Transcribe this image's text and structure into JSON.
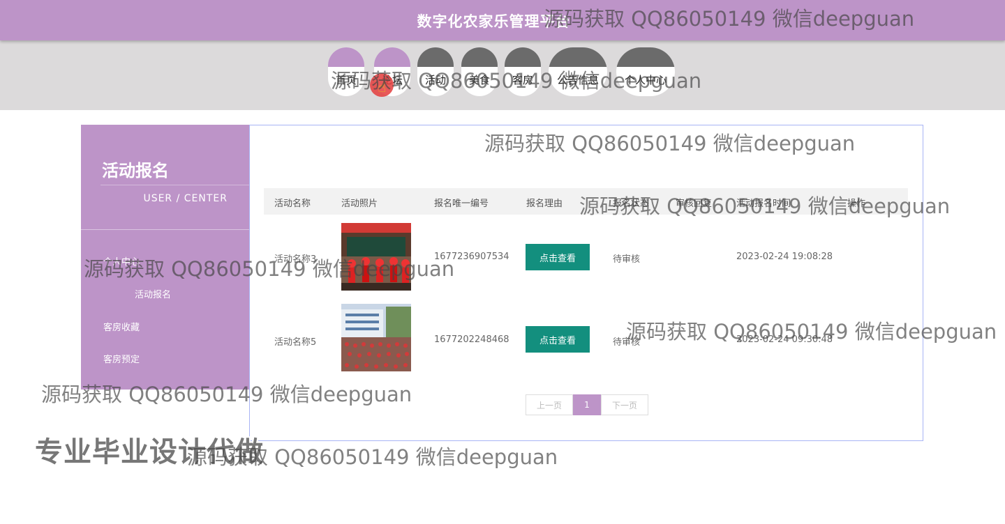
{
  "header": {
    "title": "数字化农家乐管理平台"
  },
  "nav": [
    {
      "label": "首页",
      "active": true
    },
    {
      "label": "论坛",
      "active": true
    },
    {
      "label": "活动",
      "active": false
    },
    {
      "label": "美食",
      "active": false
    },
    {
      "label": "客房",
      "active": false
    },
    {
      "label": "公告信息",
      "active": false
    },
    {
      "label": "个人中心",
      "active": false
    }
  ],
  "sidebar": {
    "title": "活动报名",
    "subtitle": "USER / CENTER",
    "items": [
      {
        "label": "个人中心"
      },
      {
        "label": "活动报名"
      },
      {
        "label": "客房收藏"
      },
      {
        "label": "客房预定"
      }
    ]
  },
  "table": {
    "headers": [
      "活动名称",
      "活动照片",
      "报名唯一编号",
      "报名理由",
      "报名状态",
      "审核回复",
      "活动报名时间",
      "操作"
    ],
    "rows": [
      {
        "name": "活动名称3",
        "id": "1677236907534",
        "button": "点击查看",
        "status": "待审核",
        "reply": "",
        "time": "2023-02-24 19:08:28"
      },
      {
        "name": "活动名称5",
        "id": "1677202248468",
        "button": "点击查看",
        "status": "待审核",
        "reply": "",
        "time": "2023-02-24 09:30:48"
      }
    ]
  },
  "pagination": {
    "prev": "上一页",
    "current": "1",
    "next": "下一页"
  },
  "overlays": {
    "watermark": "源码获取 QQ86050149 微信deepguan",
    "badge": "专业毕业设计代做"
  },
  "colors": {
    "accent": "#bd94c8",
    "button": "#138f7e",
    "nav_dark": "#6b6b6b",
    "nav_bg": "#dcdadb"
  }
}
